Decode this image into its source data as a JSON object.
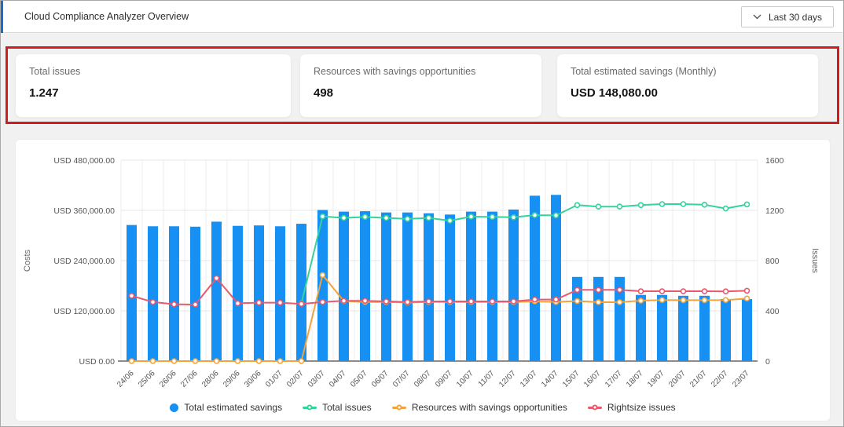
{
  "header": {
    "title": "Cloud Compliance Analyzer Overview",
    "date_range_label": "Last 30 days"
  },
  "summary_cards": [
    {
      "label": "Total issues",
      "value": "1.247"
    },
    {
      "label": "Resources with savings opportunities",
      "value": "498"
    },
    {
      "label": "Total estimated savings (Monthly)",
      "value": "USD 148,080.00"
    }
  ],
  "colors": {
    "accent_blue": "#1a6fc4",
    "highlight_red": "#cf1d1d",
    "bar_blue": "#1690f2",
    "line_green": "#34d399",
    "line_orange": "#f2a33c",
    "line_red": "#e8596f"
  },
  "chart_data": {
    "type": "bar",
    "subtype": "combo-bar-line",
    "categories": [
      "24/06",
      "25/06",
      "26/06",
      "27/06",
      "28/06",
      "29/06",
      "30/06",
      "01/07",
      "02/07",
      "03/07",
      "04/07",
      "05/07",
      "06/07",
      "07/07",
      "08/07",
      "09/07",
      "10/07",
      "11/07",
      "12/07",
      "13/07",
      "14/07",
      "15/07",
      "16/07",
      "17/07",
      "18/07",
      "19/07",
      "20/07",
      "21/07",
      "22/07",
      "23/07"
    ],
    "series": [
      {
        "name": "Total estimated savings",
        "type": "bar",
        "axis": "left",
        "color": "#1690f2",
        "values": [
          325000,
          322000,
          322000,
          321000,
          333000,
          323000,
          324000,
          322000,
          328000,
          361000,
          357000,
          358000,
          355000,
          355000,
          353000,
          350000,
          357000,
          357000,
          362000,
          395000,
          397000,
          201000,
          201000,
          201000,
          158000,
          158000,
          156000,
          156000,
          148000,
          148080
        ]
      },
      {
        "name": "Total issues",
        "type": "line",
        "axis": "right",
        "color": "#34d399",
        "values": [
          null,
          null,
          null,
          null,
          null,
          null,
          null,
          null,
          460,
          1152,
          1140,
          1148,
          1140,
          1132,
          1140,
          1118,
          1150,
          1148,
          1145,
          1162,
          1160,
          1242,
          1230,
          1230,
          1242,
          1250,
          1250,
          1245,
          1215,
          1247
        ]
      },
      {
        "name": "Resources with savings opportunities",
        "type": "line",
        "axis": "right",
        "color": "#f2a33c",
        "values": [
          0,
          0,
          0,
          0,
          0,
          0,
          0,
          0,
          0,
          685,
          478,
          470,
          470,
          466,
          470,
          470,
          470,
          470,
          470,
          475,
          470,
          478,
          469,
          469,
          481,
          486,
          485,
          485,
          486,
          498
        ]
      },
      {
        "name": "Rightsize issues",
        "type": "line",
        "axis": "right",
        "color": "#e8596f",
        "values": [
          520,
          470,
          452,
          450,
          660,
          460,
          465,
          465,
          455,
          470,
          480,
          480,
          475,
          470,
          475,
          475,
          475,
          475,
          475,
          490,
          490,
          567,
          567,
          567,
          556,
          556,
          556,
          556,
          555,
          560
        ]
      }
    ],
    "left_axis": {
      "title": "Costs",
      "min": 0,
      "max": 480000,
      "tick_labels_top_down": [
        "USD 480,000.00",
        "USD 360,000.00",
        "USD 240,000.00",
        "USD 120,000.00",
        "USD 0.00"
      ]
    },
    "right_axis": {
      "title": "Issues",
      "min": 0,
      "max": 1600,
      "tick_labels_top_down": [
        "1600",
        "1200",
        "800",
        "400",
        "0"
      ]
    },
    "grid": true,
    "legend_position": "bottom"
  }
}
